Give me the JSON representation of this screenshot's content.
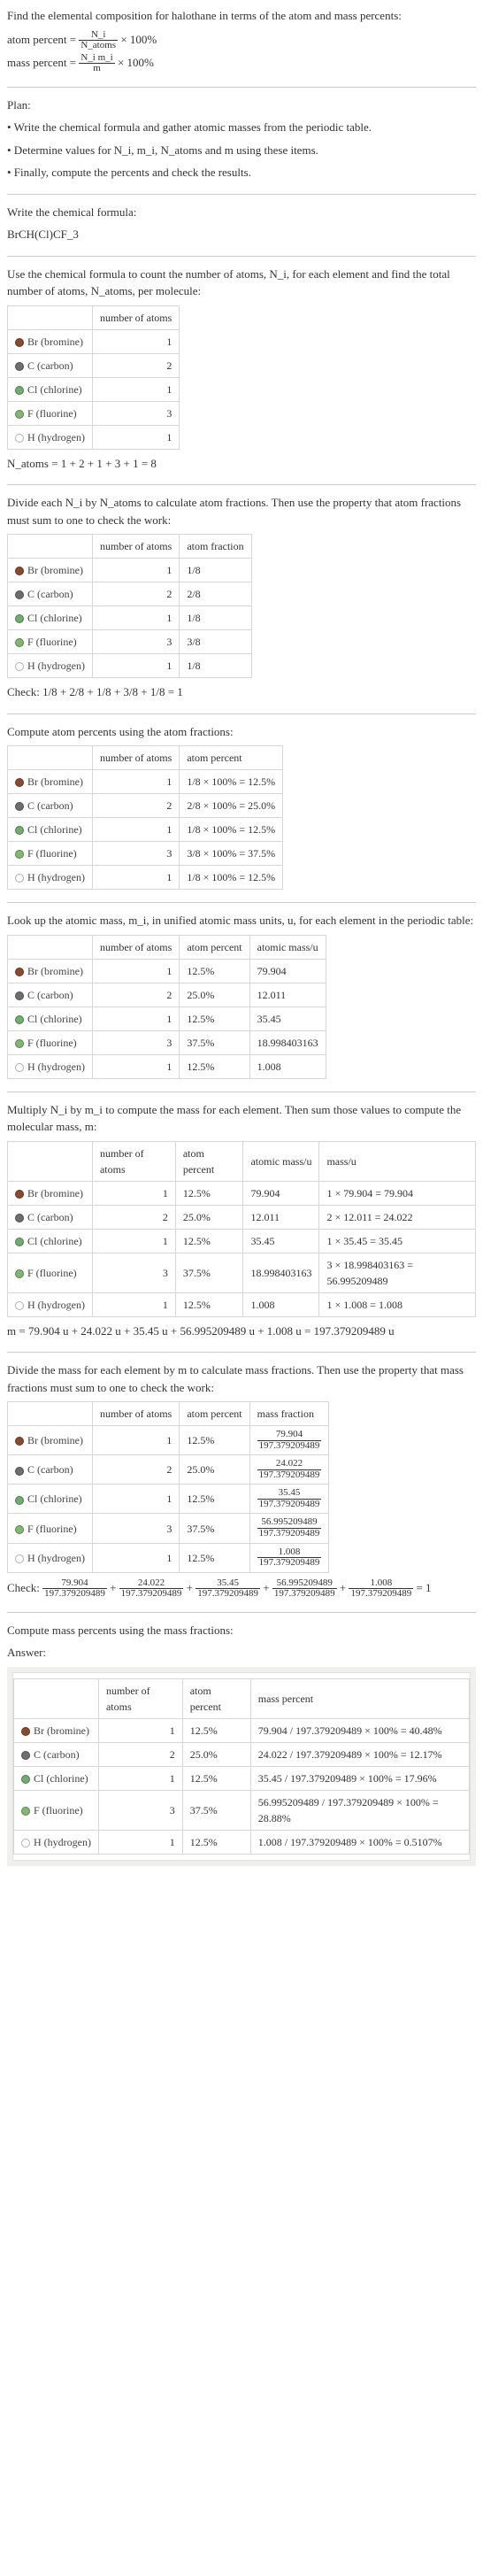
{
  "intro": {
    "title": "Find the elemental composition for halothane in terms of the atom and mass percents:",
    "atom_percent_label": "atom percent =",
    "atom_percent_expr_num": "N_i",
    "atom_percent_expr_den": "N_atoms",
    "times100": "× 100%",
    "mass_percent_label": "mass percent =",
    "mass_percent_expr_num": "N_i m_i",
    "mass_percent_expr_den": "m"
  },
  "plan": {
    "heading": "Plan:",
    "bullet1": "• Write the chemical formula and gather atomic masses from the periodic table.",
    "bullet2": "• Determine values for N_i, m_i, N_atoms and m using these items.",
    "bullet3": "• Finally, compute the percents and check the results."
  },
  "formula": {
    "text": "Write the chemical formula:",
    "value": "BrCH(Cl)CF_3"
  },
  "count_intro": "Use the chemical formula to count the number of atoms, N_i, for each element and find the total number of atoms, N_atoms, per molecule:",
  "headers": {
    "natoms": "number of atoms",
    "afrac": "atom fraction",
    "apct": "atom percent",
    "amass": "atomic mass/u",
    "massu": "mass/u",
    "mfrac": "mass fraction",
    "mpct": "mass percent"
  },
  "elements": {
    "br": {
      "name": "Br (bromine)",
      "n": "1"
    },
    "c": {
      "name": "C (carbon)",
      "n": "2"
    },
    "cl": {
      "name": "Cl (chlorine)",
      "n": "1"
    },
    "f": {
      "name": "F (fluorine)",
      "n": "3"
    },
    "h": {
      "name": "H (hydrogen)",
      "n": "1"
    }
  },
  "natoms_sum": "N_atoms = 1 + 2 + 1 + 3 + 1 = 8",
  "afrac_intro": "Divide each N_i by N_atoms to calculate atom fractions. Then use the property that atom fractions must sum to one to check the work:",
  "afrac": {
    "br": "1/8",
    "c": "2/8",
    "cl": "1/8",
    "f": "3/8",
    "h": "1/8"
  },
  "afrac_check": "Check: 1/8 + 2/8 + 1/8 + 3/8 + 1/8 = 1",
  "apct_intro": "Compute atom percents using the atom fractions:",
  "apct": {
    "br": "1/8 × 100% = 12.5%",
    "c": "2/8 × 100% = 25.0%",
    "cl": "1/8 × 100% = 12.5%",
    "f": "3/8 × 100% = 37.5%",
    "h": "1/8 × 100% = 12.5%"
  },
  "amass_intro": "Look up the atomic mass, m_i, in unified atomic mass units, u, for each element in the periodic table:",
  "apct_short": {
    "br": "12.5%",
    "c": "25.0%",
    "cl": "12.5%",
    "f": "37.5%",
    "h": "12.5%"
  },
  "amass": {
    "br": "79.904",
    "c": "12.011",
    "cl": "35.45",
    "f": "18.998403163",
    "h": "1.008"
  },
  "massu_intro": "Multiply N_i by m_i to compute the mass for each element. Then sum those values to compute the molecular mass, m:",
  "massu": {
    "br": "1 × 79.904 = 79.904",
    "c": "2 × 12.011 = 24.022",
    "cl": "1 × 35.45 = 35.45",
    "f": "3 × 18.998403163 = 56.995209489",
    "h": "1 × 1.008 = 1.008"
  },
  "m_total": "m = 79.904 u + 24.022 u + 35.45 u + 56.995209489 u + 1.008 u = 197.379209489 u",
  "mfrac_intro": "Divide the mass for each element by m to calculate mass fractions. Then use the property that mass fractions must sum to one to check the work:",
  "mfrac": {
    "br": {
      "num": "79.904",
      "den": "197.379209489"
    },
    "c": {
      "num": "24.022",
      "den": "197.379209489"
    },
    "cl": {
      "num": "35.45",
      "den": "197.379209489"
    },
    "f": {
      "num": "56.995209489",
      "den": "197.379209489"
    },
    "h": {
      "num": "1.008",
      "den": "197.379209489"
    }
  },
  "mfrac_check_prefix": "Check:",
  "mfrac_check_eq": "= 1",
  "mpct_intro": "Compute mass percents using the mass fractions:",
  "answer_label": "Answer:",
  "mpct": {
    "br": "79.904 / 197.379209489 × 100% = 40.48%",
    "c": "24.022 / 197.379209489 × 100% = 12.17%",
    "cl": "35.45 / 197.379209489 × 100% = 17.96%",
    "f": "56.995209489 / 197.379209489 × 100% = 28.88%",
    "h": "1.008 / 197.379209489 × 100% = 0.5107%"
  },
  "chart_data": [
    {
      "type": "table",
      "title": "Number of atoms per molecule",
      "categories": [
        "Br",
        "C",
        "Cl",
        "F",
        "H"
      ],
      "values": [
        1,
        2,
        1,
        3,
        1
      ]
    },
    {
      "type": "table",
      "title": "Atom fractions (denominator 8)",
      "categories": [
        "Br",
        "C",
        "Cl",
        "F",
        "H"
      ],
      "values": [
        1,
        2,
        1,
        3,
        1
      ]
    },
    {
      "type": "table",
      "title": "Atom percent",
      "categories": [
        "Br",
        "C",
        "Cl",
        "F",
        "H"
      ],
      "values": [
        12.5,
        25.0,
        12.5,
        37.5,
        12.5
      ]
    },
    {
      "type": "table",
      "title": "Atomic mass (u)",
      "categories": [
        "Br",
        "C",
        "Cl",
        "F",
        "H"
      ],
      "values": [
        79.904,
        12.011,
        35.45,
        18.998403163,
        1.008
      ]
    },
    {
      "type": "table",
      "title": "Element mass (u)",
      "categories": [
        "Br",
        "C",
        "Cl",
        "F",
        "H"
      ],
      "values": [
        79.904,
        24.022,
        35.45,
        56.995209489,
        1.008
      ]
    },
    {
      "type": "table",
      "title": "Mass percent",
      "categories": [
        "Br",
        "C",
        "Cl",
        "F",
        "H"
      ],
      "values": [
        40.48,
        12.17,
        17.96,
        28.88,
        0.5107
      ]
    }
  ]
}
